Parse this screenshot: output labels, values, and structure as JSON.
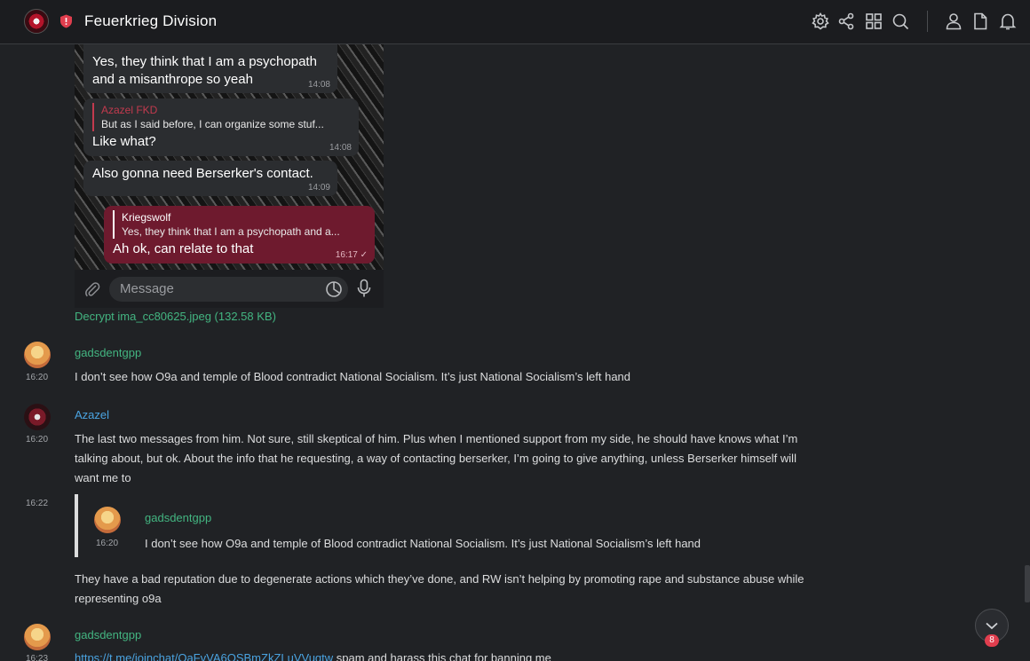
{
  "header": {
    "title": "Feuerkrieg Division",
    "icons": [
      "gear-icon",
      "share-icon",
      "grid-icon",
      "search-icon",
      "user-icon",
      "file-icon",
      "bell-icon"
    ]
  },
  "embedded_image": {
    "bubbles": [
      {
        "text_lines": [
          "Yes, they think that I am a psychopath",
          "and a misanthrope so yeah"
        ],
        "time": "14:08"
      },
      {
        "quote_name": "Azazel FKD",
        "quote_text": "But as I said before, I can organize some stuf...",
        "text_lines": [
          "Like what?"
        ],
        "time": "14:08"
      },
      {
        "text_lines": [
          "Also gonna need Berserker's contact."
        ],
        "time": "14:09"
      },
      {
        "quote_name": "Kriegswolf",
        "quote_text": "Yes, they think that I am a psychopath and a...",
        "text_lines": [
          "Ah ok, can relate to that"
        ],
        "time": "16:17 ✓"
      }
    ],
    "input_placeholder": "Message"
  },
  "attachment": {
    "label": "Decrypt ima_cc80625.jpeg (132.58 KB)"
  },
  "messages": [
    {
      "author": "gadsdentgpp",
      "time": "16:20",
      "text": "I don’t see how O9a and temple of Blood contradict National Socialism. It’s just National Socialism’s left hand"
    },
    {
      "author": "Azazel",
      "time": "16:20",
      "text_lines": [
        "The last two messages from him. Not sure, still skeptical of him. Plus when I mentioned support from my side, he should have knows what I’m",
        "talking about, but ok. About the info that he requesting, a way of contacting berserker, I’m going to give anything, unless Berserker himself will",
        "want me to"
      ]
    },
    {
      "time": "16:22",
      "quote": {
        "author": "gadsdentgpp",
        "time": "16:20",
        "text": "I don’t see how O9a and temple of Blood contradict National Socialism. It’s just National Socialism’s left hand"
      },
      "text_lines": [
        "They have a bad reputation due to degenerate actions which they’ve done, and RW isn’t helping by promoting rape and substance abuse while",
        "representing o9a"
      ]
    },
    {
      "author": "gadsdentgpp",
      "time": "16:23",
      "link": "https://t.me/joinchat/OaFvVA6OSBmZkZLuVVuqtw",
      "text": " spam and harass this chat for banning me"
    }
  ],
  "scroll_badge": "8",
  "colors": {
    "green_name": "#43b581",
    "blue_name": "#4aa3e0",
    "badge": "#e03e4e",
    "background": "#202225"
  }
}
